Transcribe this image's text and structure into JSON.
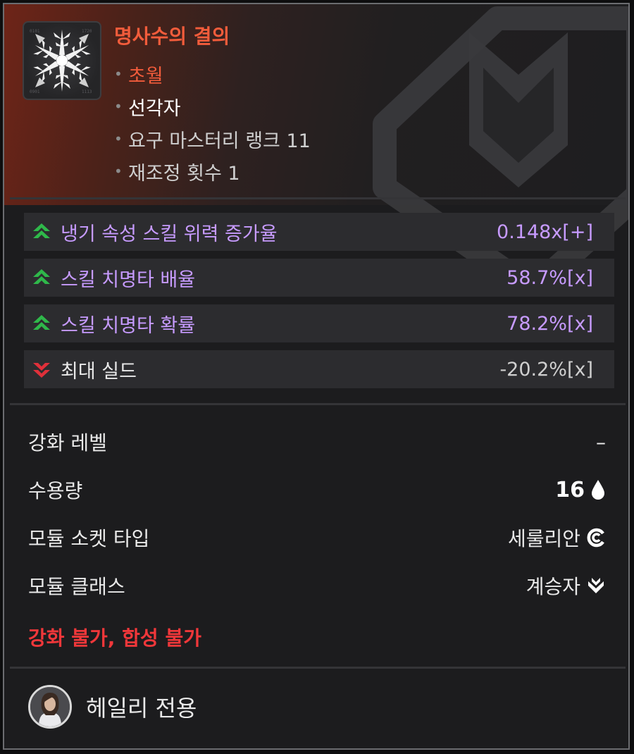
{
  "item": {
    "name": "명사수의 결의",
    "icon": "snowflake-module-icon",
    "meta": [
      "초월",
      "선각자",
      "요구 마스터리 랭크 11",
      "재조정 횟수 1"
    ],
    "bullet": "•"
  },
  "stats": [
    {
      "name": "냉기 속성 스킬 위력 증가율",
      "value": "0.148x[+]",
      "direction": "up"
    },
    {
      "name": "스킬 치명타 배율",
      "value": "58.7%[x]",
      "direction": "up"
    },
    {
      "name": "스킬 치명타 확률",
      "value": "78.2%[x]",
      "direction": "up"
    },
    {
      "name": "최대 실드",
      "value": "-20.2%[x]",
      "direction": "down"
    }
  ],
  "info": {
    "enhance_label": "강화 레벨",
    "enhance_value": "–",
    "capacity_label": "수용량",
    "capacity_value": "16",
    "socket_label": "모듈 소켓 타입",
    "socket_value": "세룰리안",
    "class_label": "모듈 클래스",
    "class_value": "계승자"
  },
  "warning": "강화 불가, 합성 불가",
  "owner": {
    "label": "헤일리 전용"
  },
  "colors": {
    "grade": "#f25c3b",
    "stat_positive": "#c79bff",
    "arrow_up": "#2fb84a",
    "arrow_down": "#e0303a",
    "warning": "#f0373a"
  }
}
